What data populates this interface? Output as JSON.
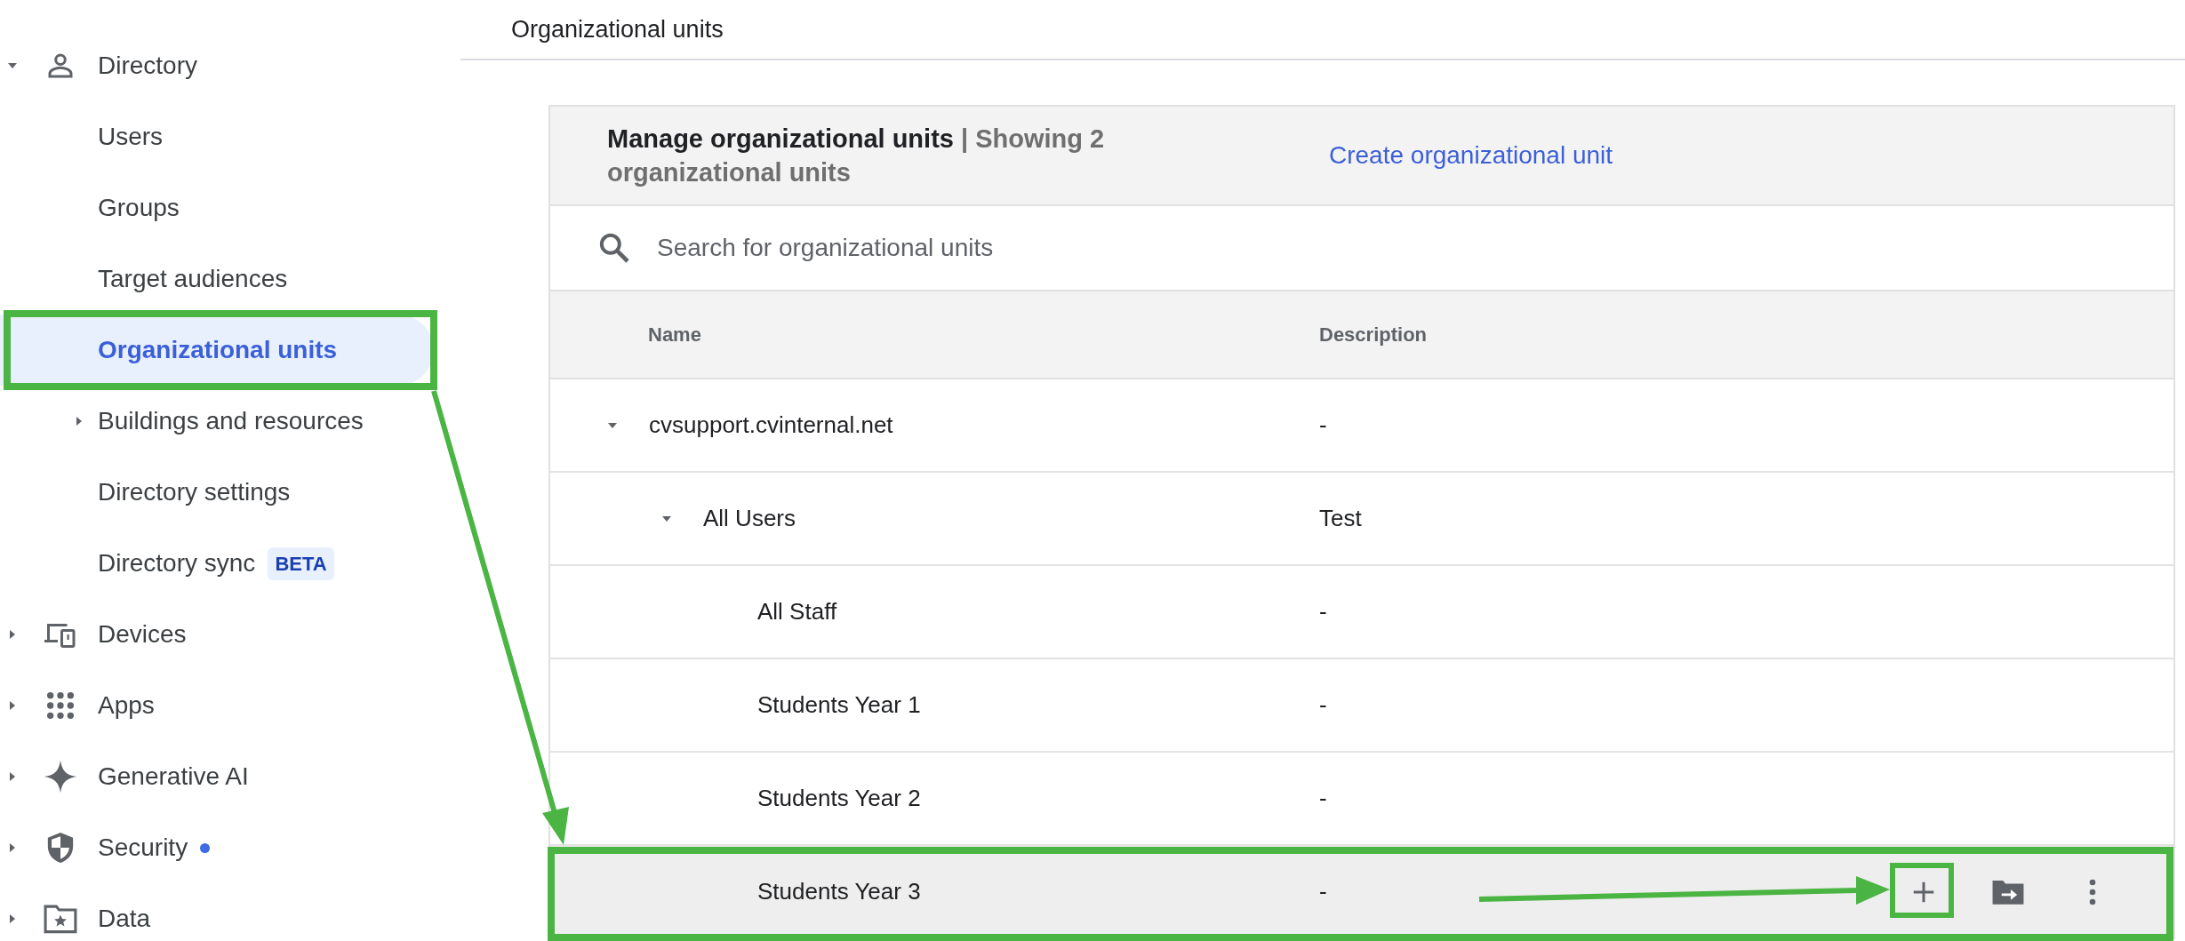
{
  "sidebar": {
    "items": [
      {
        "label": "Directory",
        "expanded": true,
        "children": [
          {
            "label": "Users",
            "selected": false
          },
          {
            "label": "Groups",
            "selected": false
          },
          {
            "label": "Target audiences",
            "selected": false
          },
          {
            "label": "Organizational units",
            "selected": true
          },
          {
            "label": "Buildings and resources",
            "selected": false,
            "expanded": false
          },
          {
            "label": "Directory settings",
            "selected": false
          },
          {
            "label": "Directory sync",
            "selected": false,
            "badge": "BETA"
          }
        ]
      },
      {
        "label": "Devices",
        "expanded": false
      },
      {
        "label": "Apps",
        "expanded": false
      },
      {
        "label": "Generative AI",
        "expanded": false
      },
      {
        "label": "Security",
        "expanded": false,
        "notification": true
      },
      {
        "label": "Data",
        "expanded": false
      }
    ]
  },
  "page": {
    "title": "Organizational units"
  },
  "card": {
    "title": "Manage organizational units",
    "subtitle": "| Showing 2 organizational units",
    "create_link": "Create organizational unit",
    "search": {
      "placeholder": "Search for organizational units"
    },
    "columns": [
      "Name",
      "Description"
    ],
    "rows": [
      {
        "name": "cvsupport.cvinternal.net",
        "description": "-",
        "expanded": true,
        "hovered": false,
        "children": [
          {
            "name": "All Users",
            "description": "Test",
            "expanded": true,
            "hovered": false,
            "children": [
              {
                "name": "All Staff",
                "description": "-",
                "hovered": false
              },
              {
                "name": "Students Year 1",
                "description": "-",
                "hovered": false
              },
              {
                "name": "Students Year 2",
                "description": "-",
                "hovered": false
              },
              {
                "name": "Students Year 3",
                "description": "-",
                "hovered": true
              }
            ]
          }
        ]
      }
    ]
  }
}
